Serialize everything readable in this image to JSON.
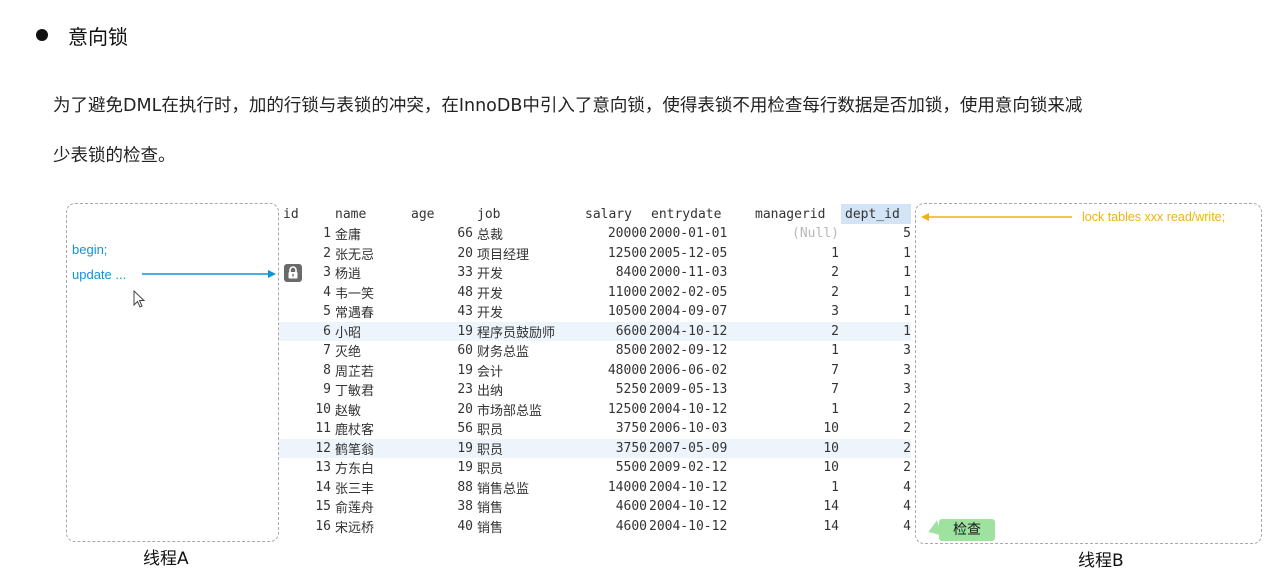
{
  "heading": "意向锁",
  "paragraph": {
    "line1": "为了避免DML在执行时，加的行锁与表锁的冲突，在InnoDB中引入了意向锁，使得表锁不用检查每行数据是否加锁，使用意向锁来减",
    "line2": "少表锁的检查。"
  },
  "thread_a": {
    "label": "线程A",
    "code_begin": "begin;",
    "code_update": "update ..."
  },
  "thread_b": {
    "label": "线程B",
    "lock_command": "lock tables xxx read/write;",
    "check_badge": "检查"
  },
  "colors": {
    "code_blue": "#0d95d8",
    "lock_yellow": "#f0b20e",
    "badge_green": "#9fe2a0"
  },
  "table": {
    "columns": {
      "id": "id",
      "name": "name",
      "age": "age",
      "job": "job",
      "salary": "salary",
      "entrydate": "entrydate",
      "managerid": "managerid",
      "dept_id": "dept_id"
    },
    "rows": [
      {
        "id": "1",
        "name": "金庸",
        "age": "66",
        "job": "总裁",
        "salary": "20000",
        "entrydate": "2000-01-01",
        "managerid": "(Null)",
        "dept_id": "5"
      },
      {
        "id": "2",
        "name": "张无忌",
        "age": "20",
        "job": "项目经理",
        "salary": "12500",
        "entrydate": "2005-12-05",
        "managerid": "1",
        "dept_id": "1"
      },
      {
        "id": "3",
        "name": "杨逍",
        "age": "33",
        "job": "开发",
        "salary": "8400",
        "entrydate": "2000-11-03",
        "managerid": "2",
        "dept_id": "1"
      },
      {
        "id": "4",
        "name": "韦一笑",
        "age": "48",
        "job": "开发",
        "salary": "11000",
        "entrydate": "2002-02-05",
        "managerid": "2",
        "dept_id": "1"
      },
      {
        "id": "5",
        "name": "常遇春",
        "age": "43",
        "job": "开发",
        "salary": "10500",
        "entrydate": "2004-09-07",
        "managerid": "3",
        "dept_id": "1"
      },
      {
        "id": "6",
        "name": "小昭",
        "age": "19",
        "job": "程序员鼓励师",
        "salary": "6600",
        "entrydate": "2004-10-12",
        "managerid": "2",
        "dept_id": "1"
      },
      {
        "id": "7",
        "name": "灭绝",
        "age": "60",
        "job": "财务总监",
        "salary": "8500",
        "entrydate": "2002-09-12",
        "managerid": "1",
        "dept_id": "3"
      },
      {
        "id": "8",
        "name": "周芷若",
        "age": "19",
        "job": "会计",
        "salary": "48000",
        "entrydate": "2006-06-02",
        "managerid": "7",
        "dept_id": "3"
      },
      {
        "id": "9",
        "name": "丁敏君",
        "age": "23",
        "job": "出纳",
        "salary": "5250",
        "entrydate": "2009-05-13",
        "managerid": "7",
        "dept_id": "3"
      },
      {
        "id": "10",
        "name": "赵敏",
        "age": "20",
        "job": "市场部总监",
        "salary": "12500",
        "entrydate": "2004-10-12",
        "managerid": "1",
        "dept_id": "2"
      },
      {
        "id": "11",
        "name": "鹿杖客",
        "age": "56",
        "job": "职员",
        "salary": "3750",
        "entrydate": "2006-10-03",
        "managerid": "10",
        "dept_id": "2"
      },
      {
        "id": "12",
        "name": "鹤笔翁",
        "age": "19",
        "job": "职员",
        "salary": "3750",
        "entrydate": "2007-05-09",
        "managerid": "10",
        "dept_id": "2"
      },
      {
        "id": "13",
        "name": "方东白",
        "age": "19",
        "job": "职员",
        "salary": "5500",
        "entrydate": "2009-02-12",
        "managerid": "10",
        "dept_id": "2"
      },
      {
        "id": "14",
        "name": "张三丰",
        "age": "88",
        "job": "销售总监",
        "salary": "14000",
        "entrydate": "2004-10-12",
        "managerid": "1",
        "dept_id": "4"
      },
      {
        "id": "15",
        "name": "俞莲舟",
        "age": "38",
        "job": "销售",
        "salary": "4600",
        "entrydate": "2004-10-12",
        "managerid": "14",
        "dept_id": "4"
      },
      {
        "id": "16",
        "name": "宋远桥",
        "age": "40",
        "job": "销售",
        "salary": "4600",
        "entrydate": "2004-10-12",
        "managerid": "14",
        "dept_id": "4"
      }
    ],
    "locked_row_index": 2,
    "highlighted_row_indices": [
      5,
      11
    ]
  }
}
